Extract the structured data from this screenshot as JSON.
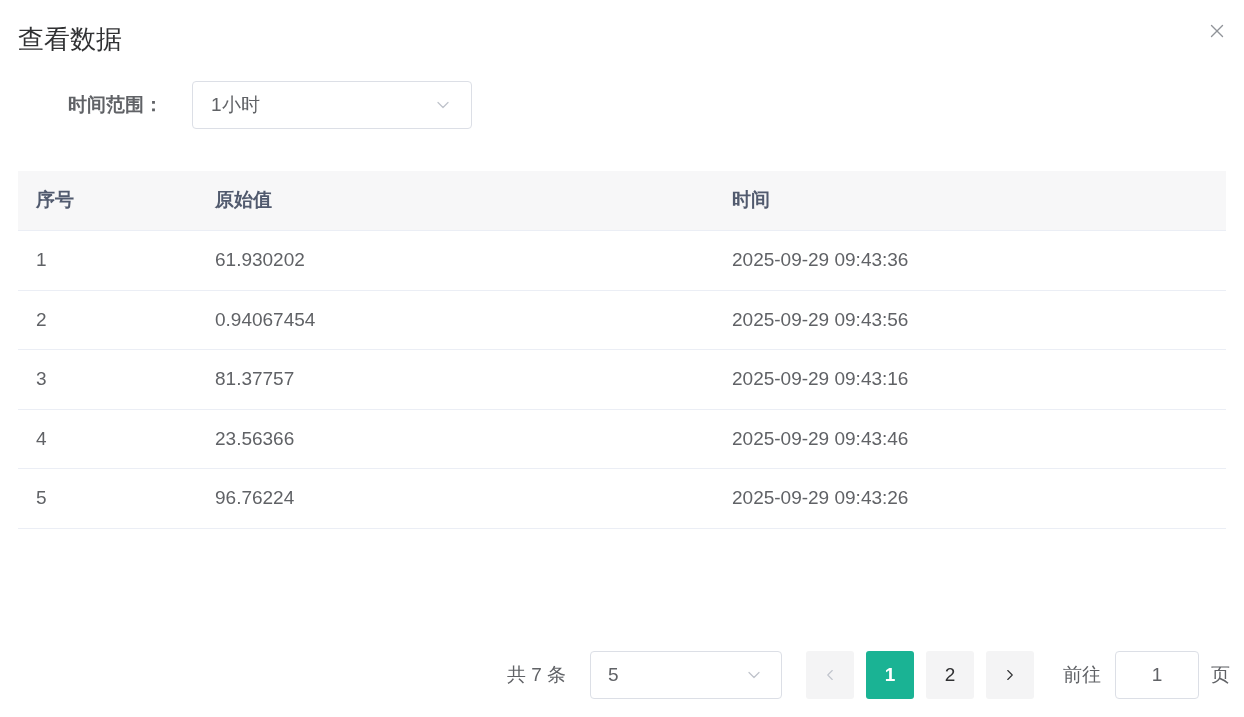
{
  "dialog": {
    "title": "查看数据"
  },
  "filter": {
    "label": "时间范围：",
    "value": "1小时"
  },
  "table": {
    "columns": [
      "序号",
      "原始值",
      "时间"
    ],
    "rows": [
      [
        "1",
        "61.930202",
        "2025-09-29 09:43:36"
      ],
      [
        "2",
        "0.94067454",
        "2025-09-29 09:43:56"
      ],
      [
        "3",
        "81.37757",
        "2025-09-29 09:43:16"
      ],
      [
        "4",
        "23.56366",
        "2025-09-29 09:43:46"
      ],
      [
        "5",
        "96.76224",
        "2025-09-29 09:43:26"
      ]
    ]
  },
  "pagination": {
    "total": "共 7 条",
    "page_size": "5",
    "prev_disabled": true,
    "next_disabled": false,
    "pages": [
      {
        "label": "1",
        "selected": true
      },
      {
        "label": "2",
        "selected": false
      }
    ],
    "goto_label": "前往",
    "goto_value": "1",
    "page_suffix": "页"
  }
}
